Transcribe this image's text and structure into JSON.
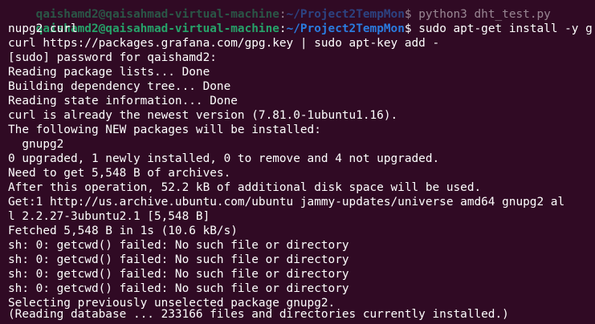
{
  "colors": {
    "background": "#300a24",
    "text": "#ffffff",
    "prompt_user": "#26a269",
    "prompt_path": "#2a7bde"
  },
  "prompt": {
    "top_clipped": {
      "user": "qaishamd2@qaisahmad-virtual-machine",
      "sep": ":",
      "path": "~/Project2TempMon",
      "tail": "$ python3 dht_test.py"
    },
    "user": "qaishamd2@qaisahmad-virtual-machine",
    "sep": ":",
    "path": "~/Project2TempMon",
    "command": "$ sudo apt-get install -y g"
  },
  "lines": [
    "nupg2 curl",
    "curl https://packages.grafana.com/gpg.key | sudo apt-key add -",
    "[sudo] password for qaishamd2:",
    "Reading package lists... Done",
    "Building dependency tree... Done",
    "Reading state information... Done",
    "curl is already the newest version (7.81.0-1ubuntu1.16).",
    "The following NEW packages will be installed:",
    "  gnupg2",
    "0 upgraded, 1 newly installed, 0 to remove and 4 not upgraded.",
    "Need to get 5,548 B of archives.",
    "After this operation, 52.2 kB of additional disk space will be used.",
    "Get:1 http://us.archive.ubuntu.com/ubuntu jammy-updates/universe amd64 gnupg2 al",
    "l 2.2.27-3ubuntu2.1 [5,548 B]",
    "Fetched 5,548 B in 1s (10.6 kB/s)",
    "sh: 0: getcwd() failed: No such file or directory",
    "sh: 0: getcwd() failed: No such file or directory",
    "sh: 0: getcwd() failed: No such file or directory",
    "sh: 0: getcwd() failed: No such file or directory",
    "Selecting previously unselected package gnupg2.",
    "(Reading database ... 233166 files and directories currently installed.)"
  ]
}
